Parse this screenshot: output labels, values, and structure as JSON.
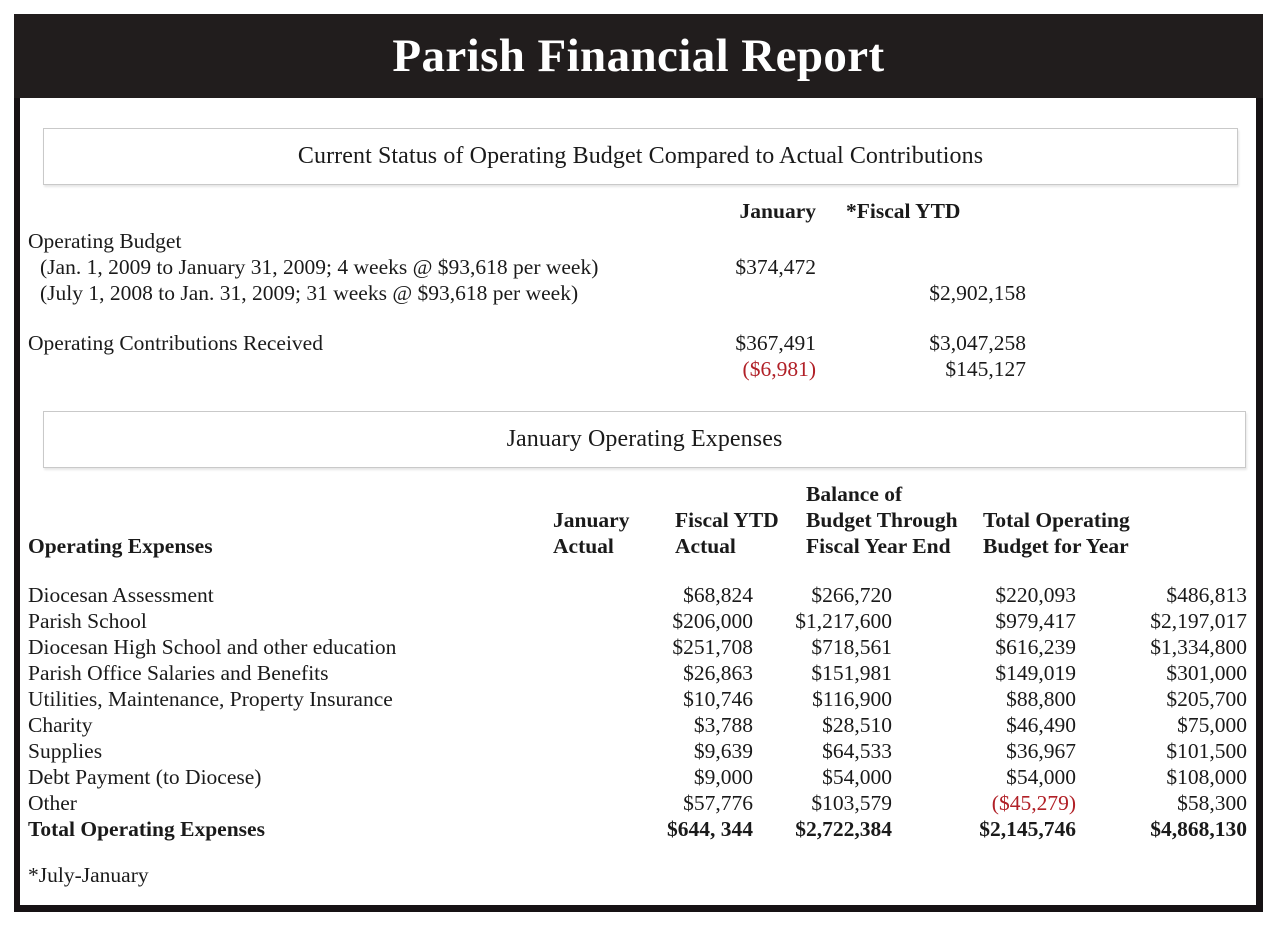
{
  "document": {
    "title": "Parish Financial Report",
    "footnote": "*July-January"
  },
  "colors": {
    "header_background": "#211d1d",
    "header_text": "#ffffff",
    "body_text": "#1a1a1a",
    "negative": "#b12027",
    "box_border": "#c9c9c9",
    "frame": "#161214"
  },
  "budget_section": {
    "heading": "Current Status of Operating Budget Compared to Actual Contributions",
    "column_headers": {
      "january": "January",
      "fiscal_ytd": "*Fiscal YTD"
    },
    "rows": [
      {
        "label": "Operating Budget",
        "january": "",
        "fiscal_ytd": ""
      },
      {
        "label": "(Jan. 1, 2009 to January 31, 2009; 4 weeks @ $93,618 per week)",
        "january": "$374,472",
        "fiscal_ytd": ""
      },
      {
        "label": "(July 1, 2008 to Jan. 31, 2009; 31 weeks @ $93,618 per week)",
        "january": "",
        "fiscal_ytd": "$2,902,158"
      },
      {
        "label": "Operating Contributions Received",
        "january": "$367,491",
        "fiscal_ytd": "$3,047,258"
      },
      {
        "label": "",
        "january": "($6,981)",
        "january_negative": true,
        "fiscal_ytd": "$145,127"
      }
    ]
  },
  "expenses_section": {
    "heading": "January Operating Expenses",
    "row_label_header": "Operating Expenses",
    "column_headers": [
      {
        "line1": "",
        "line2": "January",
        "line3": "Actual"
      },
      {
        "line1": "",
        "line2": "Fiscal YTD",
        "line3": "Actual"
      },
      {
        "line1": "Balance of",
        "line2": "Budget Through",
        "line3": "Fiscal Year End"
      },
      {
        "line1": "",
        "line2": "Total Operating",
        "line3": "Budget for Year"
      }
    ],
    "rows": [
      {
        "label": "Diocesan Assessment",
        "january_actual": "$68,824",
        "fiscal_ytd_actual": "$266,720",
        "balance_of_budget": "$220,093",
        "total_budget": "$486,813"
      },
      {
        "label": "Parish School",
        "january_actual": "$206,000",
        "fiscal_ytd_actual": "$1,217,600",
        "balance_of_budget": "$979,417",
        "total_budget": "$2,197,017"
      },
      {
        "label": "Diocesan High School and other education",
        "january_actual": "$251,708",
        "fiscal_ytd_actual": "$718,561",
        "balance_of_budget": "$616,239",
        "total_budget": "$1,334,800"
      },
      {
        "label": "Parish Office Salaries and Benefits",
        "january_actual": "$26,863",
        "fiscal_ytd_actual": "$151,981",
        "balance_of_budget": "$149,019",
        "total_budget": "$301,000"
      },
      {
        "label": "Utilities, Maintenance, Property Insurance",
        "january_actual": "$10,746",
        "fiscal_ytd_actual": "$116,900",
        "balance_of_budget": "$88,800",
        "total_budget": "$205,700"
      },
      {
        "label": "Charity",
        "january_actual": "$3,788",
        "fiscal_ytd_actual": "$28,510",
        "balance_of_budget": "$46,490",
        "total_budget": "$75,000"
      },
      {
        "label": "Supplies",
        "january_actual": "$9,639",
        "fiscal_ytd_actual": "$64,533",
        "balance_of_budget": "$36,967",
        "total_budget": "$101,500"
      },
      {
        "label": "Debt Payment (to Diocese)",
        "january_actual": "$9,000",
        "fiscal_ytd_actual": "$54,000",
        "balance_of_budget": "$54,000",
        "total_budget": "$108,000"
      },
      {
        "label": "Other",
        "january_actual": "$57,776",
        "fiscal_ytd_actual": "$103,579",
        "balance_of_budget": "($45,279)",
        "balance_negative": true,
        "total_budget": "$58,300"
      }
    ],
    "total_row": {
      "label": "Total Operating Expenses",
      "january_actual": "$644, 344",
      "fiscal_ytd_actual": "$2,722,384",
      "balance_of_budget": "$2,145,746",
      "total_budget": "$4,868,130"
    }
  }
}
